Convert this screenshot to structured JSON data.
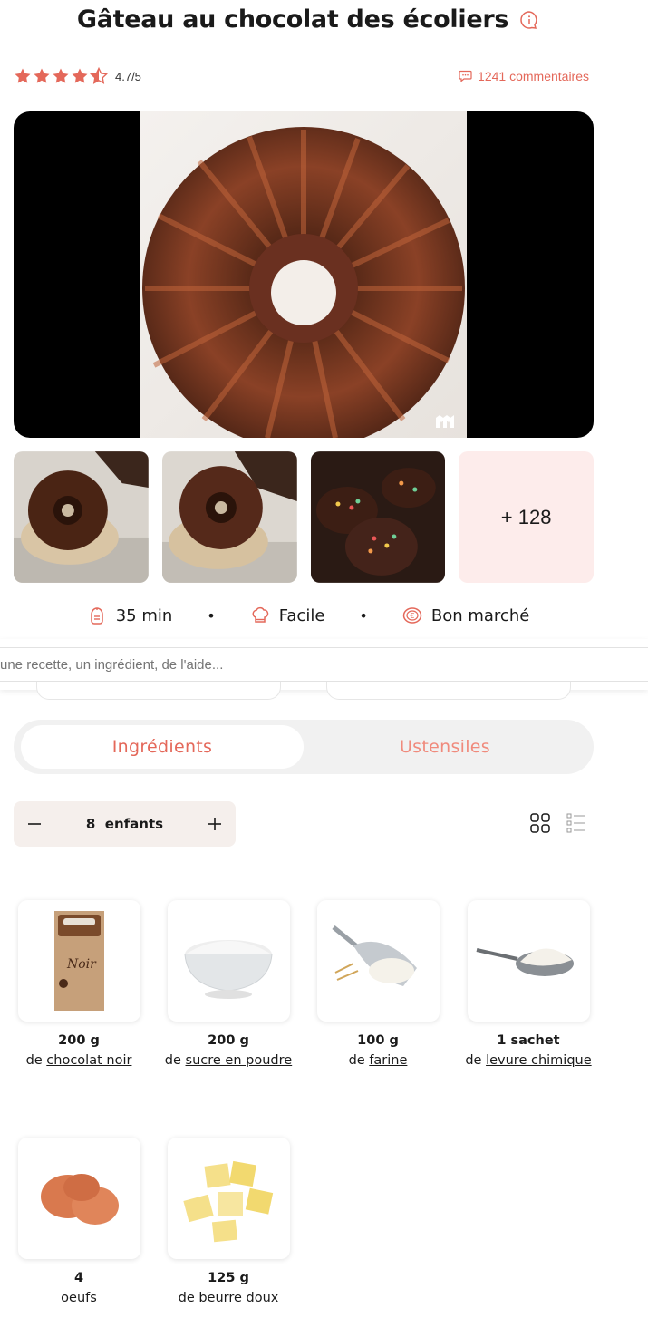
{
  "recipe": {
    "title": "Gâteau au chocolat des écoliers",
    "rating_text": "4.7/5",
    "rating_value": 4.7,
    "comments_label": "1241 commentaires"
  },
  "gallery": {
    "more_label": "+ 128"
  },
  "meta": {
    "time": "35 min",
    "difficulty": "Facile",
    "cost": "Bon marché"
  },
  "search": {
    "placeholder": "une recette, un ingrédient, de l'aide..."
  },
  "tabs": {
    "ingredients": "Ingrédients",
    "utensils": "Ustensiles"
  },
  "servings": {
    "count": "8",
    "unit": "enfants"
  },
  "ingredients": [
    {
      "qty": "200 g",
      "prefix": "de",
      "name": "chocolat noir"
    },
    {
      "qty": "200 g",
      "prefix": "de",
      "name": "sucre en poudre"
    },
    {
      "qty": "100 g",
      "prefix": "de",
      "name": "farine"
    },
    {
      "qty": "1 sachet",
      "prefix": "de",
      "name": "levure chimique"
    },
    {
      "qty": "4",
      "prefix": "",
      "name": "oeufs"
    },
    {
      "qty": "125 g",
      "prefix": "de",
      "name": "beurre doux"
    }
  ],
  "colors": {
    "accent": "#e4685a",
    "tab_bg": "#f1f1f1",
    "more_bg": "#fdeceb"
  }
}
